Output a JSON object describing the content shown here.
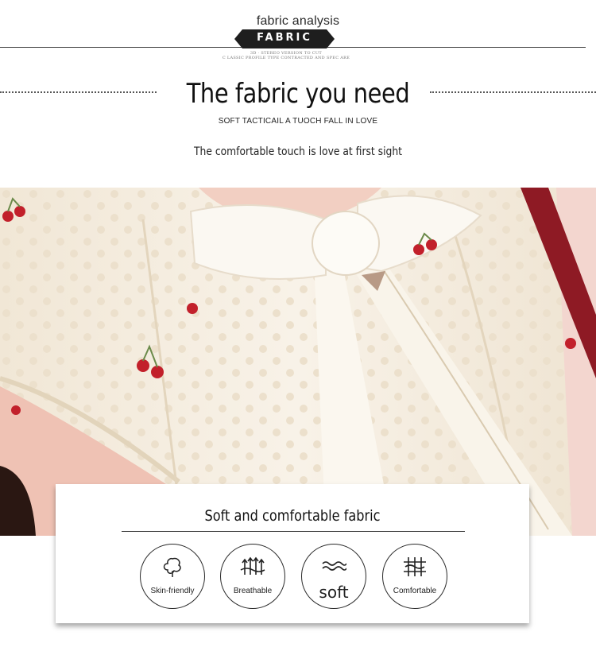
{
  "header": {
    "small_title": "fabric analysis",
    "badge": "FABRIC",
    "tiny_line_1": "3D · STEREO VERSION TO CUT",
    "tiny_line_2": "C LASSIC PROFILE TYPE CONTRACTED AND SPEC ARE"
  },
  "hero": {
    "title": "The fabric you need",
    "subtitle": "SOFT TACTICAIL A TUOCH FALL IN LOVE",
    "tagline": "The comfortable touch is love at first sight"
  },
  "card": {
    "title": "Soft and comfortable fabric",
    "features": [
      {
        "label": "Skin-friendly",
        "icon": "cotton-icon"
      },
      {
        "label": "Breathable",
        "icon": "breathable-arrows-icon"
      },
      {
        "label": "soft",
        "icon": "waves-icon"
      },
      {
        "label": "Comfortable",
        "icon": "comfort-arrows-icon"
      }
    ]
  },
  "colors": {
    "badge_bg": "#1e1e1e",
    "fabric_cream": "#f3ece0",
    "cherry_red": "#c2202b",
    "trim_red": "#8e1a24"
  }
}
